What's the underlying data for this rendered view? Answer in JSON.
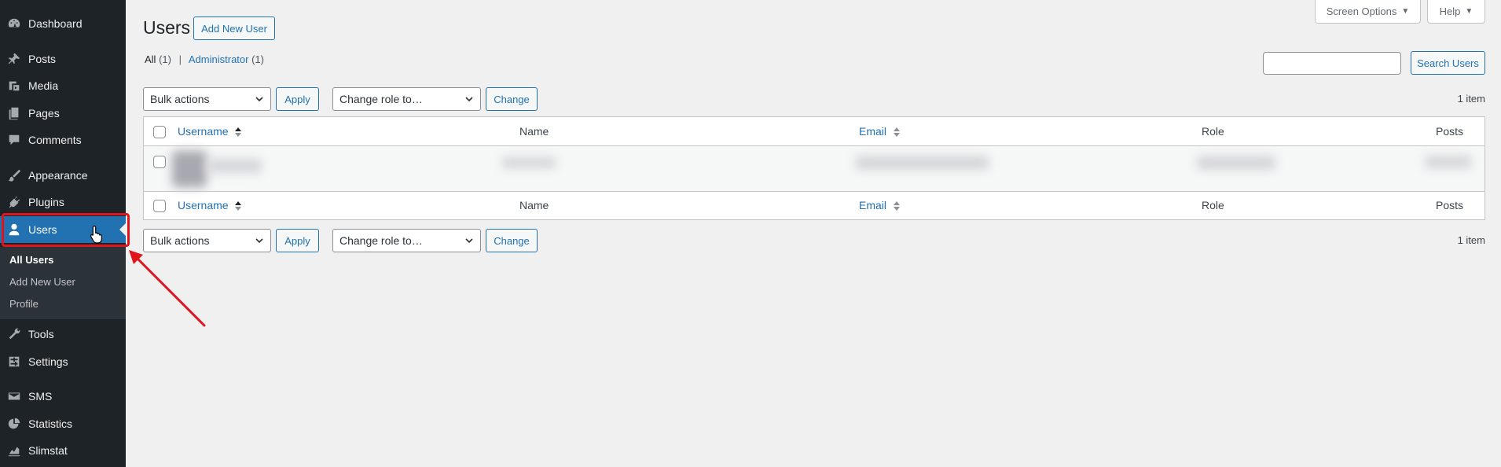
{
  "sidebar": {
    "items": [
      {
        "label": "Dashboard",
        "icon": "dashboard-icon"
      },
      {
        "label": "Posts",
        "icon": "pin-icon"
      },
      {
        "label": "Media",
        "icon": "media-icon"
      },
      {
        "label": "Pages",
        "icon": "pages-icon"
      },
      {
        "label": "Comments",
        "icon": "comment-icon"
      },
      {
        "label": "Appearance",
        "icon": "paintbrush-icon"
      },
      {
        "label": "Plugins",
        "icon": "plugin-icon"
      },
      {
        "label": "Users",
        "icon": "user-icon"
      },
      {
        "label": "Tools",
        "icon": "wrench-icon"
      },
      {
        "label": "Settings",
        "icon": "settings-icon"
      },
      {
        "label": "SMS",
        "icon": "email-icon"
      },
      {
        "label": "Statistics",
        "icon": "chart-pie-icon"
      },
      {
        "label": "Slimstat",
        "icon": "chart-line-icon"
      }
    ],
    "submenu": [
      "All Users",
      "Add New User",
      "Profile"
    ]
  },
  "header": {
    "title": "Users",
    "add_new_label": "Add New User",
    "screen_options_label": "Screen Options",
    "help_label": "Help"
  },
  "filters": {
    "all_label": "All",
    "all_count": "(1)",
    "separator": "|",
    "admin_label": "Administrator",
    "admin_count": "(1)"
  },
  "search": {
    "button_label": "Search Users",
    "value": ""
  },
  "bulk": {
    "bulk_actions": "Bulk actions",
    "apply": "Apply",
    "change_role": "Change role to…",
    "change": "Change",
    "item_count": "1 item"
  },
  "table": {
    "columns": [
      "Username",
      "Name",
      "Email",
      "Role",
      "Posts"
    ]
  },
  "colors": {
    "sidebar_bg": "#1d2327",
    "accent": "#2271b1",
    "highlight": "#e0151b"
  }
}
